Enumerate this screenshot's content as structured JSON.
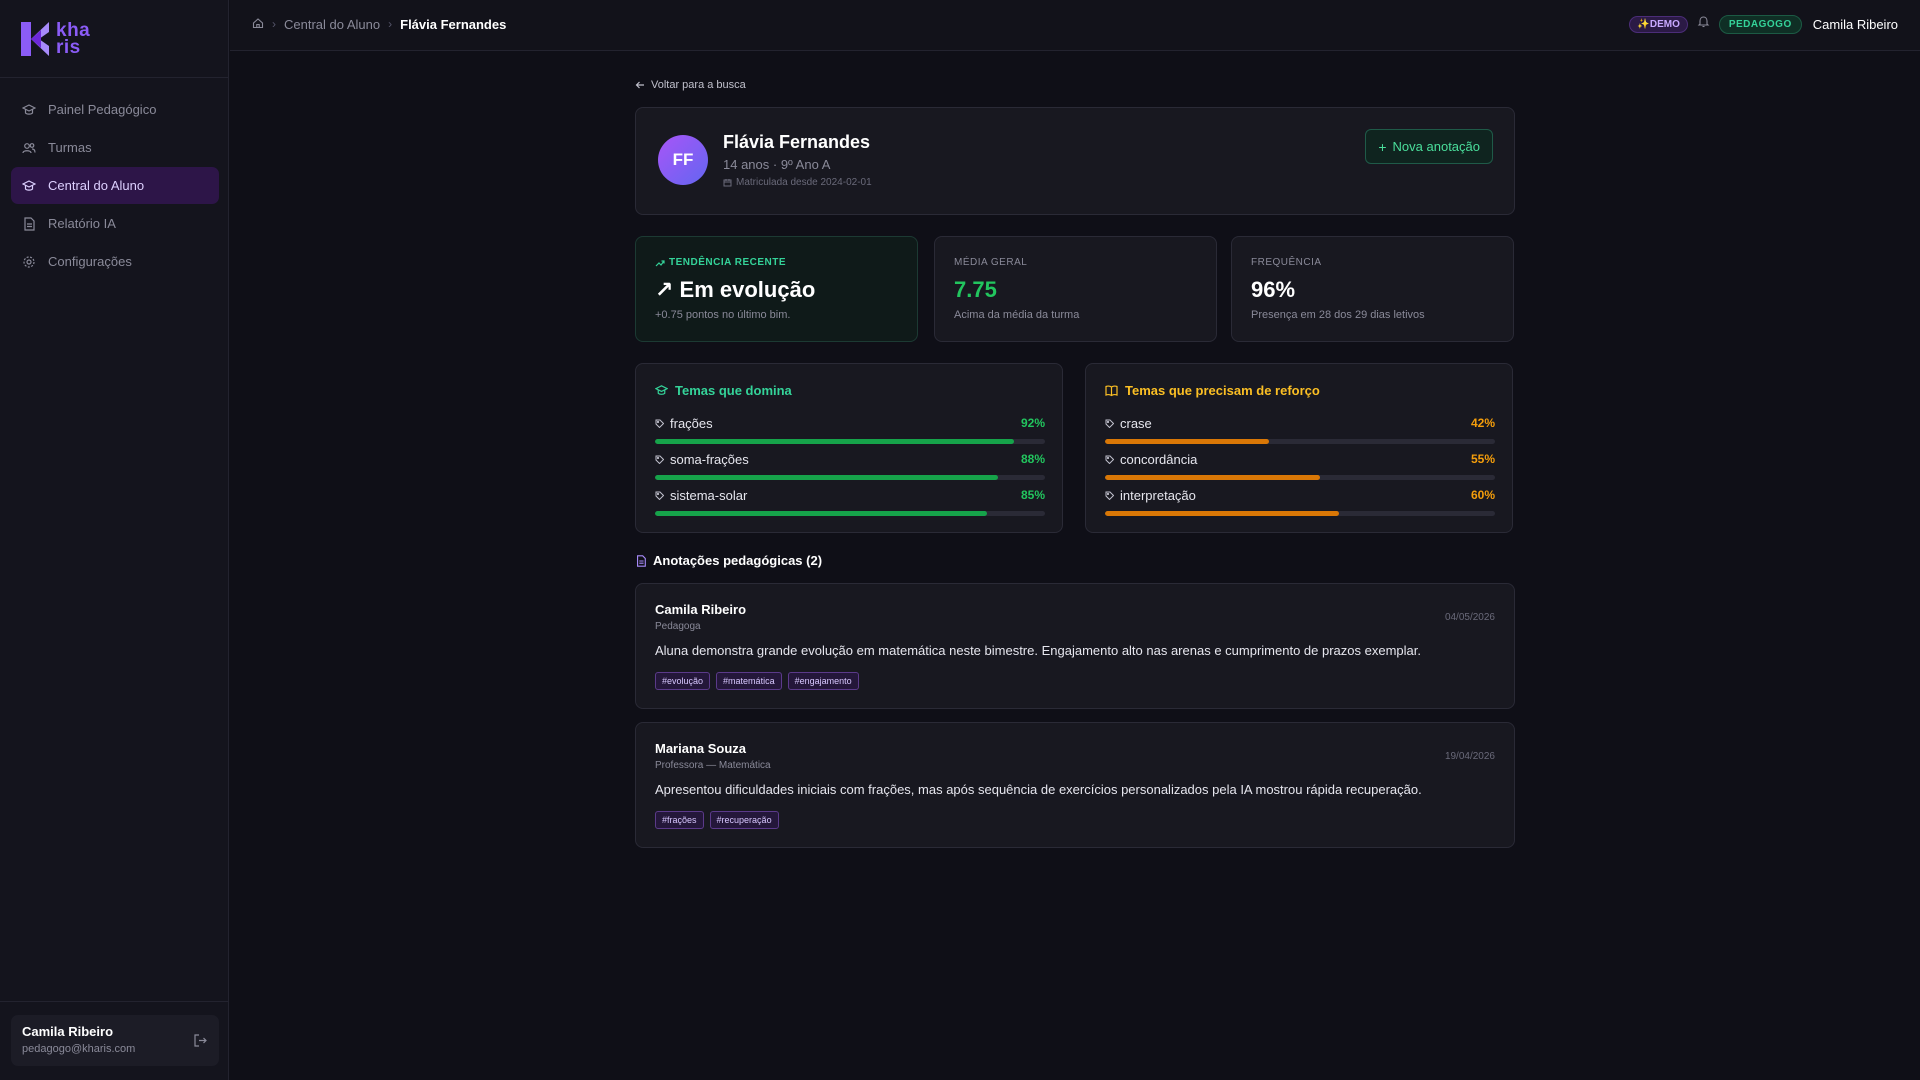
{
  "app": {
    "logo_text_top": "kha",
    "logo_text_bottom": "ris",
    "brand_color": "#8b5cf6"
  },
  "sidebar": {
    "items": [
      {
        "label": "Painel Pedagógico",
        "icon": "graduation-cap-icon"
      },
      {
        "label": "Turmas",
        "icon": "users-icon"
      },
      {
        "label": "Central do Aluno",
        "icon": "graduation-cap-icon",
        "active": true
      },
      {
        "label": "Relatório IA",
        "icon": "document-icon"
      },
      {
        "label": "Configurações",
        "icon": "gear-icon"
      }
    ],
    "user": {
      "name": "Camila Ribeiro",
      "email": "pedagogo@kharis.com"
    }
  },
  "header": {
    "breadcrumb": [
      "Central do Aluno",
      "Flávia Fernandes"
    ],
    "demo_badge": "DEMO",
    "role_badge": "PEDAGOGO",
    "user_name": "Camila Ribeiro"
  },
  "main": {
    "back_label": "Voltar para a busca",
    "student": {
      "initials": "FF",
      "name": "Flávia Fernandes",
      "meta": "14 anos · 9º Ano A",
      "since": "Matriculada desde 2024-02-01"
    },
    "new_note_label": "Nova anotação",
    "stats": {
      "trend": {
        "label": "TENDÊNCIA RECENTE",
        "value": "↗ Em evolução",
        "sub": "+0.75 pontos no último bim."
      },
      "average": {
        "label": "MÉDIA GERAL",
        "value": "7.75",
        "sub": "Acima da média da turma"
      },
      "frequency": {
        "label": "FREQUÊNCIA",
        "value": "96%",
        "sub": "Presença em 28 dos 29 dias letivos"
      }
    },
    "mastered": {
      "title": "Temas que domina",
      "items": [
        {
          "name": "frações",
          "pct_label": "92%",
          "pct": 92
        },
        {
          "name": "soma-frações",
          "pct_label": "88%",
          "pct": 88
        },
        {
          "name": "sistema-solar",
          "pct_label": "85%",
          "pct": 85
        }
      ]
    },
    "reinforce": {
      "title": "Temas que precisam de reforço",
      "items": [
        {
          "name": "crase",
          "pct_label": "42%",
          "pct": 42
        },
        {
          "name": "concordância",
          "pct_label": "55%",
          "pct": 55
        },
        {
          "name": "interpretação",
          "pct_label": "60%",
          "pct": 60
        }
      ]
    },
    "notes_title": "Anotações pedagógicas (2)",
    "notes": [
      {
        "author": "Camila Ribeiro",
        "role": "Pedagoga",
        "date": "04/05/2026",
        "text": "Aluna demonstra grande evolução em matemática neste bimestre. Engajamento alto nas arenas e cumprimento de prazos exemplar.",
        "tags": [
          "#evolução",
          "#matemática",
          "#engajamento"
        ]
      },
      {
        "author": "Mariana Souza",
        "role": "Professora — Matemática",
        "date": "19/04/2026",
        "text": "Apresentou dificuldades iniciais com frações, mas após sequência de exercícios personalizados pela IA mostrou rápida recuperação.",
        "tags": [
          "#frações",
          "#recuperação"
        ]
      }
    ]
  }
}
